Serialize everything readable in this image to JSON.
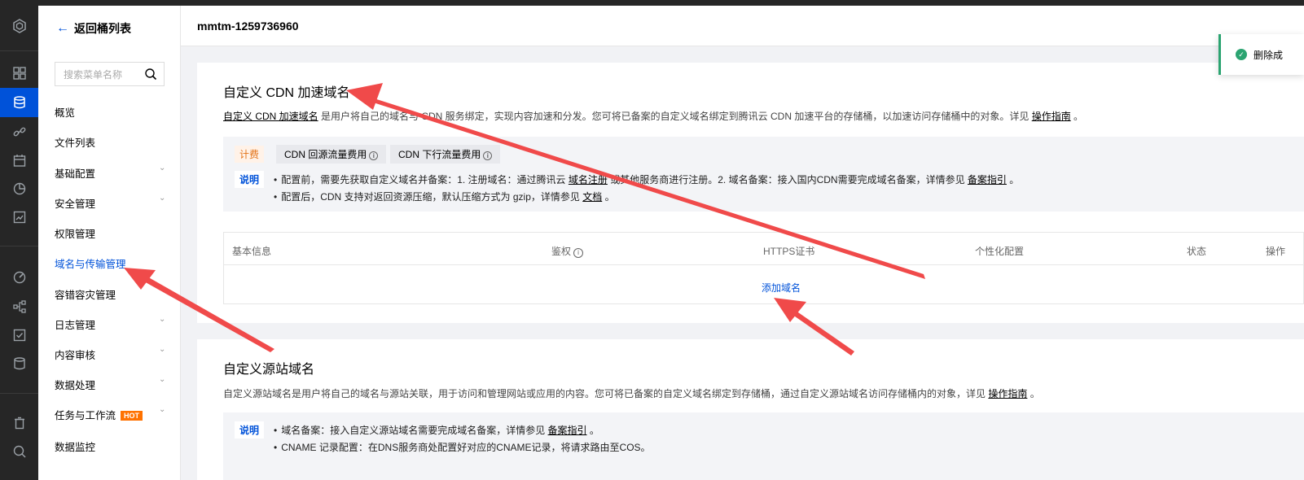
{
  "bucket_name": "mmtm-1259736960",
  "back_label": "返回桶列表",
  "search": {
    "placeholder": "搜索菜单名称"
  },
  "menu": [
    {
      "label": "概览",
      "expandable": false,
      "active": false
    },
    {
      "label": "文件列表",
      "expandable": false,
      "active": false
    },
    {
      "label": "基础配置",
      "expandable": true,
      "active": false
    },
    {
      "label": "安全管理",
      "expandable": true,
      "active": false
    },
    {
      "label": "权限管理",
      "expandable": false,
      "active": false
    },
    {
      "label": "域名与传输管理",
      "expandable": false,
      "active": true
    },
    {
      "label": "容错容灾管理",
      "expandable": false,
      "active": false
    },
    {
      "label": "日志管理",
      "expandable": true,
      "active": false
    },
    {
      "label": "内容审核",
      "expandable": true,
      "active": false
    },
    {
      "label": "数据处理",
      "expandable": true,
      "active": false
    },
    {
      "label": "任务与工作流",
      "expandable": true,
      "active": false,
      "badge": "HOT"
    },
    {
      "label": "数据监控",
      "expandable": false,
      "active": false
    }
  ],
  "cdn_section": {
    "title": "自定义 CDN 加速域名",
    "desc_link": "自定义 CDN 加速域名",
    "desc_text": " 是用户将自己的域名与 CDN 服务绑定，实现内容加速和分发。您可将已备案的自定义域名绑定到腾讯云 CDN 加速平台的存储桶，以加速访问存储桶中的对象。详见 ",
    "desc_guide": "操作指南",
    "desc_end": " 。",
    "fee_tag": "计费",
    "fee_pill_1": "CDN 回源流量费用",
    "fee_pill_2": "CDN 下行流量费用",
    "info_tag": "说明",
    "note1_a": "配置前，需要先获取自定义域名并备案：1. 注册域名：通过腾讯云 ",
    "note1_link1": "域名注册",
    "note1_b": " 或其他服务商进行注册。2. 域名备案：接入国内CDN需要完成域名备案，详情参见 ",
    "note1_link2": "备案指引",
    "note1_c": " 。",
    "note2_a": "配置后，CDN 支持对返回资源压缩，默认压缩方式为 gzip，详情参见 ",
    "note2_link": "文档",
    "note2_b": " 。",
    "table_headers": [
      "基本信息",
      "鉴权",
      "HTTPS证书",
      "个性化配置",
      "状态",
      "操作"
    ],
    "add_domain": "添加域名"
  },
  "origin_section": {
    "title": "自定义源站域名",
    "desc_text": "自定义源站域名是用户将自己的域名与源站关联，用于访问和管理网站或应用的内容。您可将已备案的自定义域名绑定到存储桶，通过自定义源站域名访问存储桶内的对象，详见 ",
    "desc_guide": "操作指南",
    "desc_end": " 。",
    "info_tag": "说明",
    "note1_a": "域名备案：接入自定义源站域名需要完成域名备案，详情参见 ",
    "note1_link": "备案指引",
    "note1_b": " 。",
    "note2": "CNAME 记录配置：在DNS服务商处配置好对应的CNAME记录，将请求路由至COS。"
  },
  "toast": {
    "text": "删除成"
  },
  "colors": {
    "accent": "#0052d9",
    "annotation": "#f04a4a",
    "success": "#2ba471",
    "rail": "#262626"
  }
}
